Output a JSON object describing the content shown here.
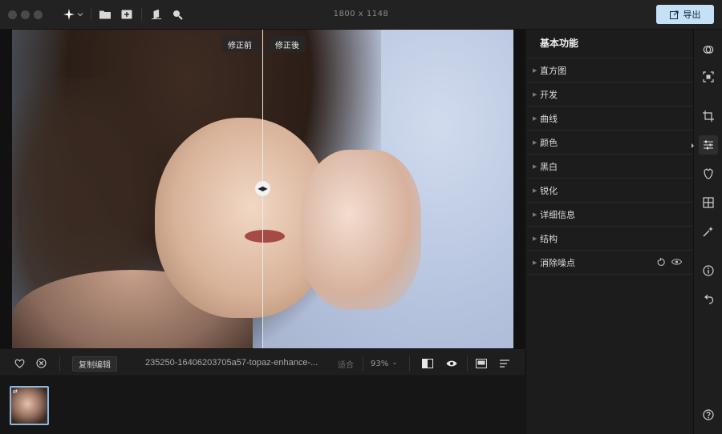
{
  "toolbar": {
    "dimensions": "1800 x 1148",
    "export_label": "导出",
    "icons": [
      "sparkle-icon",
      "chevron-down-icon",
      "folder-icon",
      "add-image-icon",
      "eraser-icon",
      "search-icon"
    ]
  },
  "canvas": {
    "before_label": "修正前",
    "after_label": "修正後",
    "split_handle_glyph": "◀▶"
  },
  "bottom_bar": {
    "copy_edit_label": "复制编辑",
    "filename": "235250-16406203705a57-topaz-enhance-...",
    "fit_label": "适合",
    "zoom_value": "93%",
    "zoom_chevron": "⌄"
  },
  "panel": {
    "title": "基本功能",
    "sections": [
      {
        "label": "直方图"
      },
      {
        "label": "开发"
      },
      {
        "label": "曲线"
      },
      {
        "label": "颜色"
      },
      {
        "label": "黑白"
      },
      {
        "label": "锐化"
      },
      {
        "label": "详细信息"
      },
      {
        "label": "结构"
      },
      {
        "label": "消除噪点"
      }
    ],
    "arrow_glyph": "▶"
  },
  "colors": {
    "accent": "#c6e1f5",
    "thumb_border": "#8ab8e0",
    "background": "#1a1a1a",
    "panel": "#1c1c1c"
  }
}
